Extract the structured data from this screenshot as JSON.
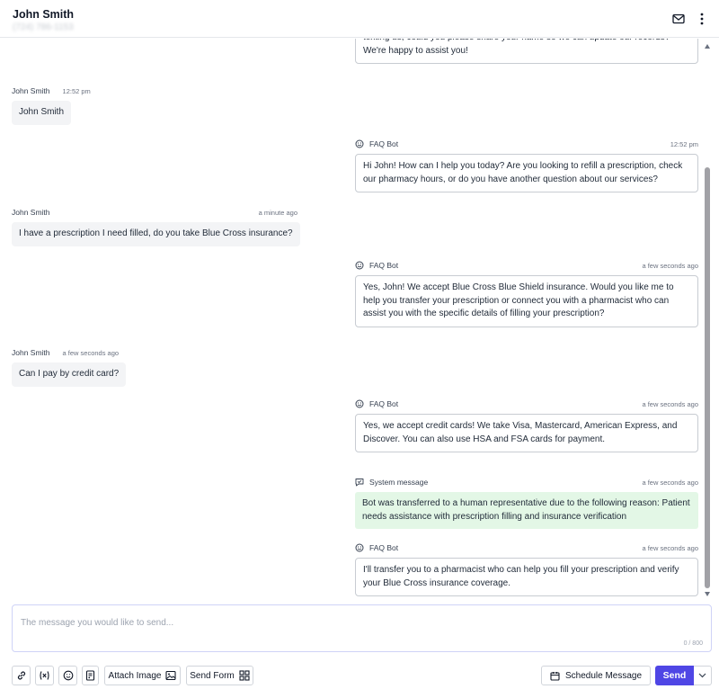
{
  "header": {
    "contact_name": "John Smith",
    "contact_phone": "(724) 786-1153"
  },
  "composer": {
    "placeholder": "The message you would like to send...",
    "char_count": "0 / 800"
  },
  "toolbar": {
    "attach_image_label": "Attach Image",
    "send_form_label": "Send Form",
    "schedule_label": "Schedule Message",
    "send_label": "Send"
  },
  "messages": [
    {
      "kind": "bot",
      "sender": "",
      "time": "",
      "text": "texting us, could you please share your name so we can update our records? We're happy to assist you!"
    },
    {
      "kind": "user",
      "sender": "John Smith",
      "time": "12:52 pm",
      "text": "John Smith"
    },
    {
      "kind": "bot",
      "sender": "FAQ Bot",
      "time": "12:52 pm",
      "text": "Hi John! How can I help you today? Are you looking to refill a prescription, check our pharmacy hours, or do you have another question about our services?"
    },
    {
      "kind": "user",
      "sender": "John Smith",
      "time": "a minute ago",
      "text": "I have a prescription I need filled, do you take Blue Cross insurance?"
    },
    {
      "kind": "bot",
      "sender": "FAQ Bot",
      "time": "a few seconds ago",
      "text": "Yes, John! We accept Blue Cross Blue Shield insurance. Would you like me to help you transfer your prescription or connect you with a pharmacist who can assist you with the specific details of filling your prescription?"
    },
    {
      "kind": "user",
      "sender": "John Smith",
      "time": "a few seconds ago",
      "text": "Can I pay by credit card?"
    },
    {
      "kind": "bot",
      "sender": "FAQ Bot",
      "time": "a few seconds ago",
      "text": "Yes, we accept credit cards! We take Visa, Mastercard, American Express, and Discover. You can also use HSA and FSA cards for payment."
    },
    {
      "kind": "system",
      "sender": "System message",
      "time": "a few seconds ago",
      "text": "Bot was transferred to a human representative due to the following reason: Patient needs assistance with prescription filling and insurance verification"
    },
    {
      "kind": "bot",
      "sender": "FAQ Bot",
      "time": "a few seconds ago",
      "text": "I'll transfer you to a pharmacist who can help you fill your prescription and verify your Blue Cross insurance coverage."
    }
  ],
  "icons": {
    "mail": "mail-icon",
    "more": "more-vertical-icon",
    "bot": "bot-icon",
    "system": "chat-check-icon",
    "link": "link-icon",
    "variable": "variable-icon",
    "emoji": "emoji-icon",
    "template": "template-icon",
    "image": "image-icon",
    "grid": "grid-icon",
    "calendar": "calendar-icon",
    "caret": "chevron-down-icon"
  },
  "colors": {
    "accent": "#4f46e5",
    "system_bg": "#e3f7e6",
    "user_bg": "#f3f4f6"
  }
}
